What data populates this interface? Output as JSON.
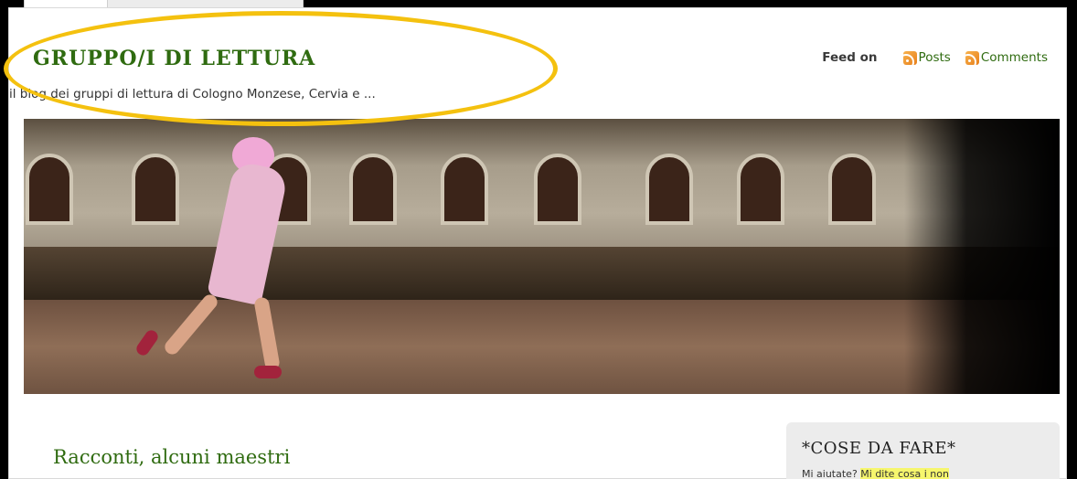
{
  "blog": {
    "title": "GRUPPO/I DI LETTURA",
    "description": "il blog dei gruppi di lettura di Cologno Monzese, Cervia e ..."
  },
  "feed": {
    "label": "Feed on",
    "posts": "Posts",
    "comments": "Comments"
  },
  "banner": {
    "icon": "photo"
  },
  "post": {
    "title": "Racconti, alcuni maestri"
  },
  "sidebar": {
    "title": "*COSE DA FARE*",
    "text_plain": "Mi aiutate? ",
    "text_highlight": "Mi dite cosa ",
    "text_rest": "i non"
  },
  "colors": {
    "title_green": "#2f6b10",
    "highlight_ellipse": "#f4c10f",
    "text_highlight": "#f6f66d"
  }
}
